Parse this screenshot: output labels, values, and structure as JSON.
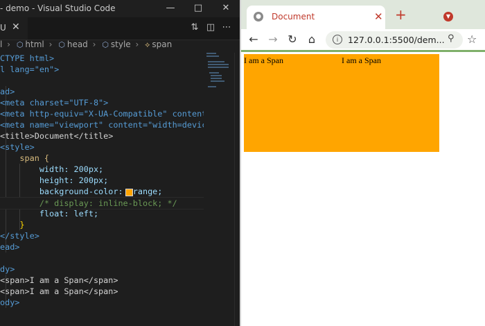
{
  "vscode": {
    "title": "- demo - Visual Studio Code",
    "window_controls": [
      "minimize",
      "restore",
      "close"
    ],
    "tab": {
      "label": "U"
    },
    "tab_tools": [
      "open-changes",
      "split-editor",
      "more-actions"
    ],
    "breadcrumb": [
      {
        "label": "l",
        "icon": ""
      },
      {
        "label": "html",
        "icon": "cube-icon"
      },
      {
        "label": "head",
        "icon": "cube-icon"
      },
      {
        "label": "style",
        "icon": "cube-icon"
      },
      {
        "label": "span",
        "icon": "selector-icon"
      }
    ],
    "lines": [
      "CTYPE html>",
      "l lang=\"en\">",
      "",
      "ad>",
      "<meta charset=\"UTF-8\">",
      "<meta http-equiv=\"X-UA-Compatible\" content=",
      "<meta name=\"viewport\" content=\"width=device",
      "<title>Document</title>",
      "<style>",
      "    span {",
      "        width: 200px;",
      "        height: 200px;",
      "        background-color: orange;",
      "        /* display: inline-block; */",
      "        float: left;",
      "    }",
      "</style>",
      "ead>",
      "",
      "dy>",
      "<span>I am a Span</span>",
      "<span>I am a Span</span>",
      "ody>"
    ]
  },
  "browser": {
    "tab_title": "Document",
    "url": "127.0.0.1:5500/dem...",
    "spans": [
      "I am a Span",
      "I am a Span"
    ],
    "span_color": "#ffa500"
  },
  "colors": {
    "editor_bg": "#1e1e1e",
    "browser_frame": "#dfe7dc",
    "browser_accent": "#c0392b"
  }
}
